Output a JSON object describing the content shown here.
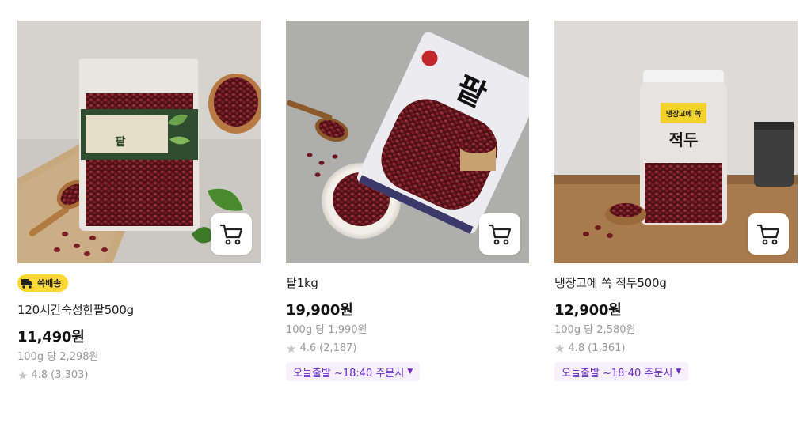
{
  "products": [
    {
      "name": "120시간숙성한팥500g",
      "badge": "쓱배송",
      "price": "11,490원",
      "unit_price": "100g 당 2,298원",
      "rating": "4.8",
      "review_count": "(3,303)",
      "package_label": "팥"
    },
    {
      "name": "팥1kg",
      "price": "19,900원",
      "unit_price": "100g 당 1,990원",
      "rating": "4.6",
      "review_count": "(2,187)",
      "delivery": "오늘출발 ~18:40 주문시",
      "package_label": "팥"
    },
    {
      "name": "냉장고에 쏙 적두500g",
      "price": "12,900원",
      "unit_price": "100g 당 2,580원",
      "rating": "4.8",
      "review_count": "(1,361)",
      "delivery": "오늘출발 ~18:40 주문시",
      "package_label": "적두",
      "jar_tag": "냉장고에 쏙"
    }
  ],
  "colors": {
    "badge_bg": "#FFD836",
    "delivery_text": "#6A2AC3",
    "delivery_bg": "#F5F0FB",
    "bean": "#7a1f25"
  },
  "icons": {
    "cart": "shopping-cart-icon",
    "star": "star-icon",
    "badge": "delivery-truck-icon",
    "caret": "caret-down-icon"
  }
}
